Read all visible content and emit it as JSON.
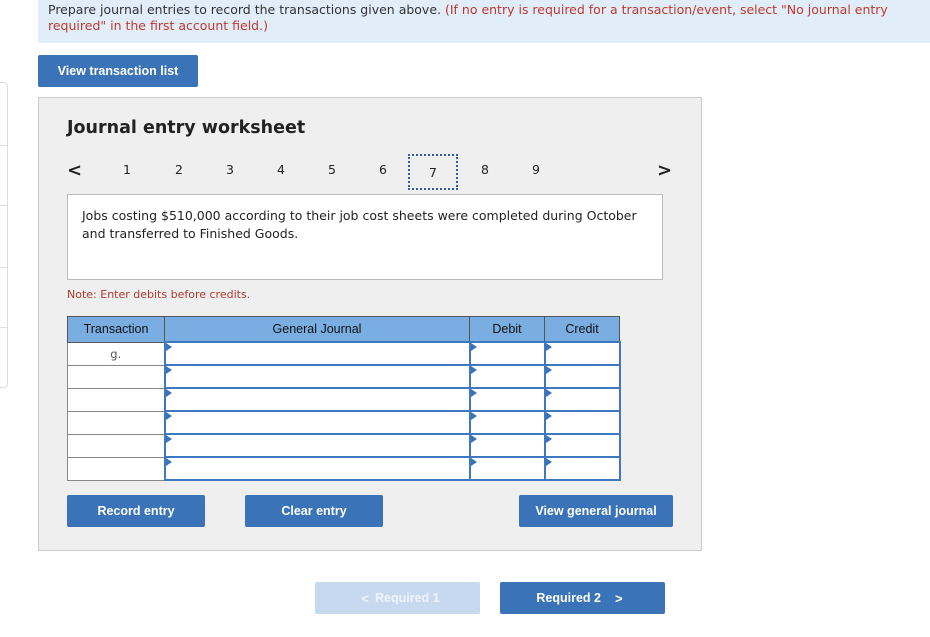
{
  "instructions": {
    "text": "Prepare journal entries to record the transactions given above. ",
    "red": "(If no entry is required for a transaction/event, select \"No journal entry required\" in the first account field.)"
  },
  "view_transaction_list": "View transaction list",
  "worksheet": {
    "title": "Journal entry worksheet",
    "pages": [
      "1",
      "2",
      "3",
      "4",
      "5",
      "6",
      "7",
      "8",
      "9"
    ],
    "active_page": "7",
    "prev": "<",
    "next": ">",
    "description": "Jobs costing $510,000 according to their job cost sheets were completed during October and transferred to Finished Goods.",
    "note": "Note: Enter debits before credits.",
    "table": {
      "headers": [
        "Transaction",
        "General Journal",
        "Debit",
        "Credit"
      ],
      "rows": [
        {
          "transaction": "g.",
          "account": "",
          "debit": "",
          "credit": ""
        },
        {
          "transaction": "",
          "account": "",
          "debit": "",
          "credit": ""
        },
        {
          "transaction": "",
          "account": "",
          "debit": "",
          "credit": ""
        },
        {
          "transaction": "",
          "account": "",
          "debit": "",
          "credit": ""
        },
        {
          "transaction": "",
          "account": "",
          "debit": "",
          "credit": ""
        },
        {
          "transaction": "",
          "account": "",
          "debit": "",
          "credit": ""
        }
      ]
    },
    "buttons": {
      "record": "Record entry",
      "clear": "Clear entry",
      "view_gj": "View general journal"
    }
  },
  "nav": {
    "prev_label": "Required 1",
    "next_label": "Required 2",
    "prev_chev": "<",
    "next_chev": ">"
  },
  "colors": {
    "button": "#3a73b8",
    "header": "#7aaee3",
    "instruction_bg": "#e1edf9",
    "panel_bg": "#efefef"
  }
}
